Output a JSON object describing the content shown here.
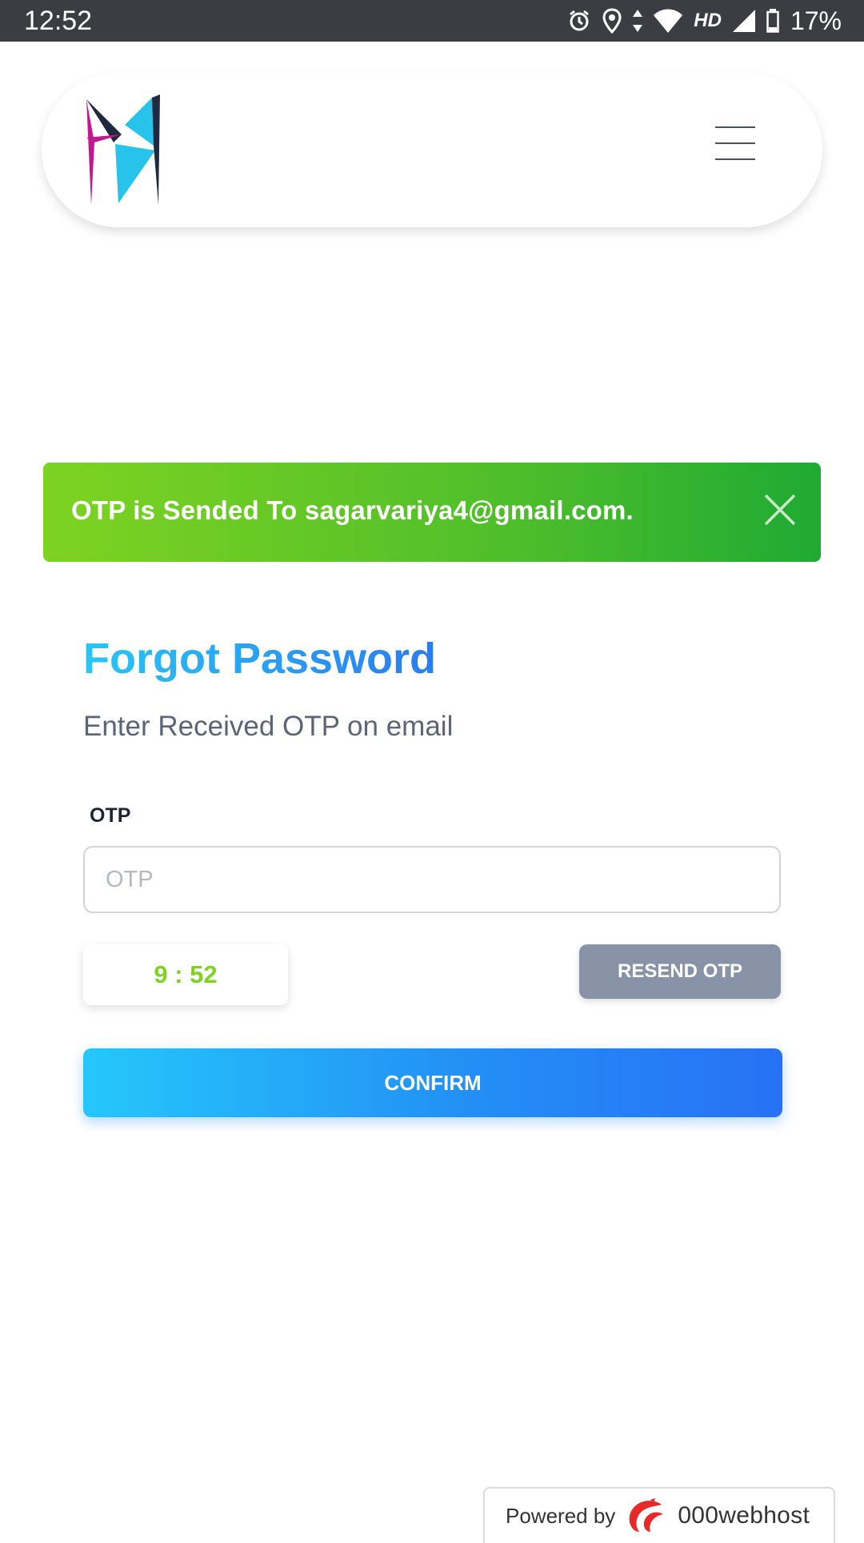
{
  "status_bar": {
    "time": "12:52",
    "network": "HD",
    "battery": "17%",
    "icons": [
      "alarm-icon",
      "location-icon",
      "data-arrows-icon",
      "wifi-icon",
      "signal-icon",
      "battery-icon"
    ]
  },
  "navbar": {
    "logo_name": "brand-logo",
    "logo_colors": [
      "#c2188f",
      "#27c3ea",
      "#1f2940"
    ],
    "menu_icon": "hamburger-menu-icon"
  },
  "alert": {
    "message": "OTP is Sended To sagarvariya4@gmail.com.",
    "close_icon": "close-icon",
    "colors": [
      "#7ed321",
      "#1faa33"
    ]
  },
  "form": {
    "title": "Forgot Password",
    "subtitle": "Enter Received OTP on email",
    "otp_label": "OTP",
    "otp_placeholder": "OTP",
    "otp_value": "",
    "timer": "9 : 52",
    "resend_label": "RESEND OTP",
    "confirm_label": "CONFIRM"
  },
  "footer": {
    "powered_by": "Powered by",
    "brand": "000webhost"
  }
}
